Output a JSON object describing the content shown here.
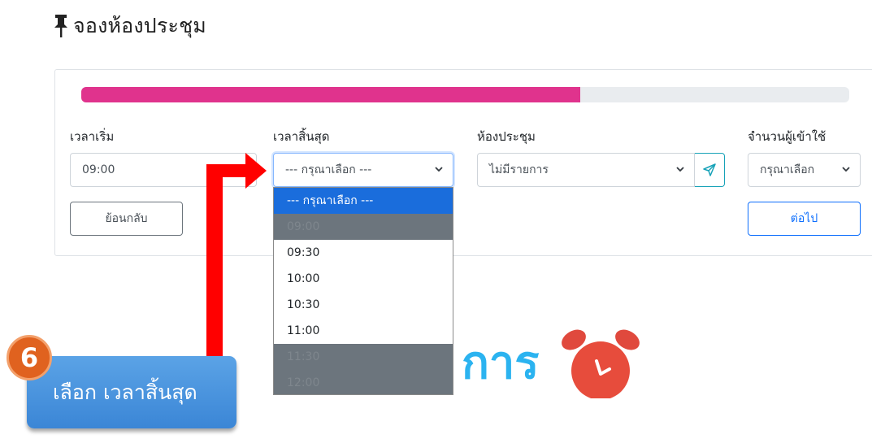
{
  "page": {
    "title": "จองห้องประชุม",
    "title_icon": "pushpin-icon"
  },
  "progress": {
    "value_percent": 65,
    "color": "#e0338d"
  },
  "fields": {
    "start_time": {
      "label": "เวลาเริ่ม",
      "value": "09:00"
    },
    "end_time": {
      "label": "เวลาสิ้นสุด",
      "value": "--- กรุณาเลือก ---"
    },
    "room": {
      "label": "ห้องประชุม",
      "value": "ไม่มีรายการ"
    },
    "attendees": {
      "label": "จำนวนผู้เข้าใช้",
      "value": "กรุณาเลือก"
    }
  },
  "buttons": {
    "back": "ย้อนกลับ",
    "next": "ต่อไป",
    "send_icon": "paper-plane-icon"
  },
  "dropdown": {
    "options": [
      {
        "label": "--- กรุณาเลือก ---",
        "state": "selected"
      },
      {
        "label": "09:00",
        "state": "disabled"
      },
      {
        "label": "09:30",
        "state": "enabled"
      },
      {
        "label": "10:00",
        "state": "enabled"
      },
      {
        "label": "10:30",
        "state": "enabled"
      },
      {
        "label": "11:00",
        "state": "enabled"
      },
      {
        "label": "11:30",
        "state": "disabled"
      },
      {
        "label": "12:00",
        "state": "disabled"
      }
    ]
  },
  "background_decor": {
    "text": "การ",
    "clock_icon": "alarm-clock-icon"
  },
  "tutorial": {
    "step": "6",
    "caption": "เลือก เวลาสิ้นสุด",
    "arrow_color": "#ff0000"
  },
  "colors": {
    "accent_blue": "#0d6efd",
    "selected_option": "#1a6ddc",
    "disabled_option": "#6c757d",
    "callout": "#4a94de"
  }
}
